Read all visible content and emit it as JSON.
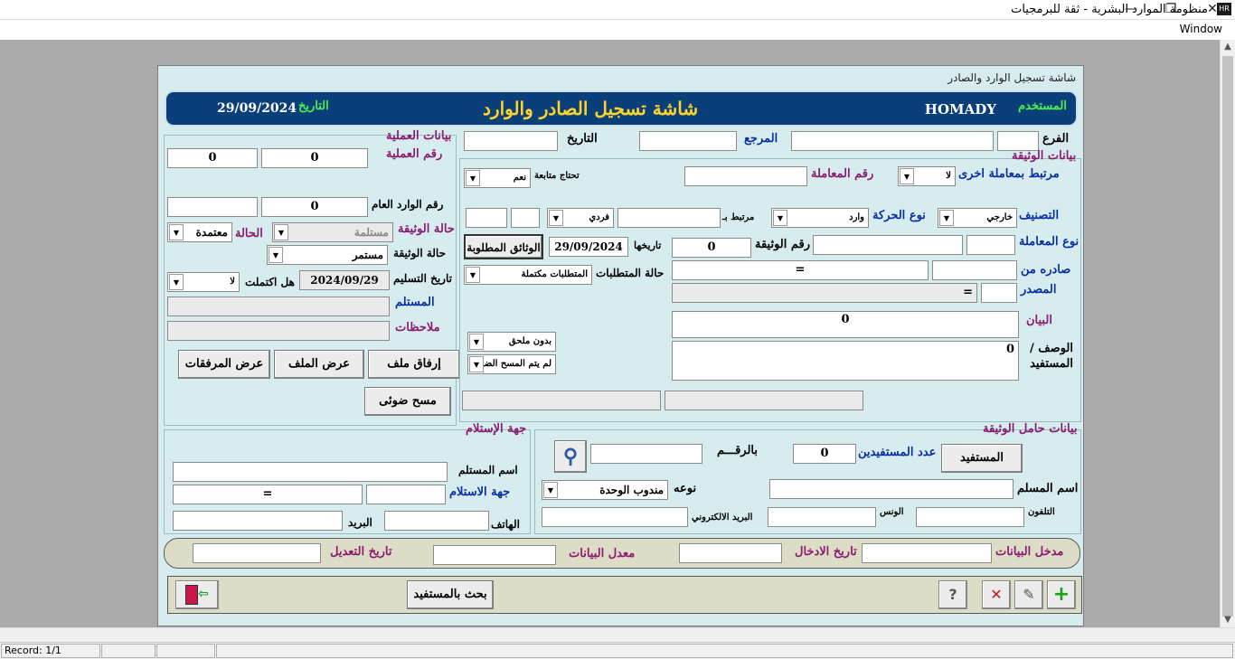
{
  "window": {
    "title": "منظومة الموارد البشرية - ثقة للبرمجيات",
    "menu": "Window",
    "minimize": "—",
    "restore": "❐",
    "close": "✕",
    "app_icon": "HR"
  },
  "form": {
    "caption": "شاشة تسجيل الوارد  والصادر"
  },
  "header": {
    "user_label": "المستخدم",
    "user": "HOMADY",
    "title": "شاشة تسجيل الصادر والوارد",
    "date_label": "التاريخ",
    "date": "29/09/2024"
  },
  "op": {
    "section": "بيانات العملية",
    "op_no_label": "رقم العملية",
    "op_no": "0",
    "op_no2": "0",
    "general_in_label": "رقم الوارد العام",
    "general_in": "0",
    "doc_state_label": "حالة الوثيقة",
    "doc_state": "مستلمة",
    "state_label": "الحالة",
    "state": "معتمدة",
    "doc_state2_label": "حالة الوثيقة",
    "doc_state2": "مستمر",
    "delivery_date_label": "تاريخ التسليم",
    "delivery_date": "2024/09/29",
    "completed_label": "هل اكتملت",
    "completed": "لا",
    "receiver_label": "المستلم",
    "notes_label": "ملاحظات",
    "attach_btn": "إرفاق ملف",
    "view_file_btn": "عرض الملف",
    "view_attach_btn": "عرض المرفقات",
    "scan_btn": "مسح ضوئى"
  },
  "doc": {
    "branch_label": "الفرع",
    "ref_label": "المرجع",
    "date_label": "التاريخ",
    "section": "بيانات الوثيقة",
    "linked_label": "مرتبط بمعاملة اخرى",
    "linked": "لا",
    "tx_no_label": "رقم المعاملة",
    "followup_label": "تحتاج متابعة",
    "followup": "نعم",
    "class_label": "التصنيف",
    "class": "خارجي",
    "move_label": "نوع الحركة",
    "move": "وارد",
    "linked_by_label": "مرتبط بـ",
    "single": "فردي",
    "tx_type_label": "نوع المعاملة",
    "doc_no_label": "رقم الوثيقة",
    "doc_no": "0",
    "doc_date_label": "تاريخها",
    "doc_date": "29/09/2024",
    "required_btn": "الوثائق المطلوبة",
    "issued_label": "صادره من",
    "issued_val": "=",
    "source_label": "المصدر",
    "source_val": "=",
    "req_state_label": "حالة المتطلبات",
    "req_state": "المتطلبات مكتملة",
    "statement_label": "البيان",
    "statement": "0",
    "desc_label": "الوصف / المستفيد",
    "desc": "0",
    "no_attach": "بدون ملحق",
    "no_scan": "لم يتم المسح الضوئي"
  },
  "holder": {
    "section": "بيانات حامل الوثيقة",
    "beneficiary_btn": "المستفيد",
    "count_label": "عدد المستفيدين",
    "count": "0",
    "by_no_label": "بالرقـــم",
    "name_label": "اسم المسلم",
    "type_label": "نوعه",
    "type": "مندوب الوحدة",
    "phone_label": "التلفون",
    "fax_label": "الونس",
    "email_label": "البريد الالكتروني"
  },
  "recv": {
    "section": "جهة الإستلام",
    "name_label": "اسم المستلم",
    "party_label": "جهة الاستلام",
    "party_val": "=",
    "phone_label": "الهاتف",
    "mail_label": "البريد"
  },
  "audit": {
    "entered_by": "مدخل البيانات",
    "entry_date": "تاريخ الادخال",
    "modified_by": "معدل البيانات",
    "mod_date": "تاريخ التعديل"
  },
  "toolbar": {
    "search_btn": "بحث بالمستفيد",
    "add": "+",
    "edit": "✎",
    "delete": "✕",
    "query": "?"
  },
  "status": {
    "record": "Record: 1/1"
  },
  "colors": {
    "header_bg": "#0a3f7a",
    "form_bg": "#d7ecee",
    "title_yellow": "#ffd42a",
    "label_green": "#4cf04c",
    "blue_label": "#0a2fa0",
    "magenta_label": "#8a1b6e"
  }
}
